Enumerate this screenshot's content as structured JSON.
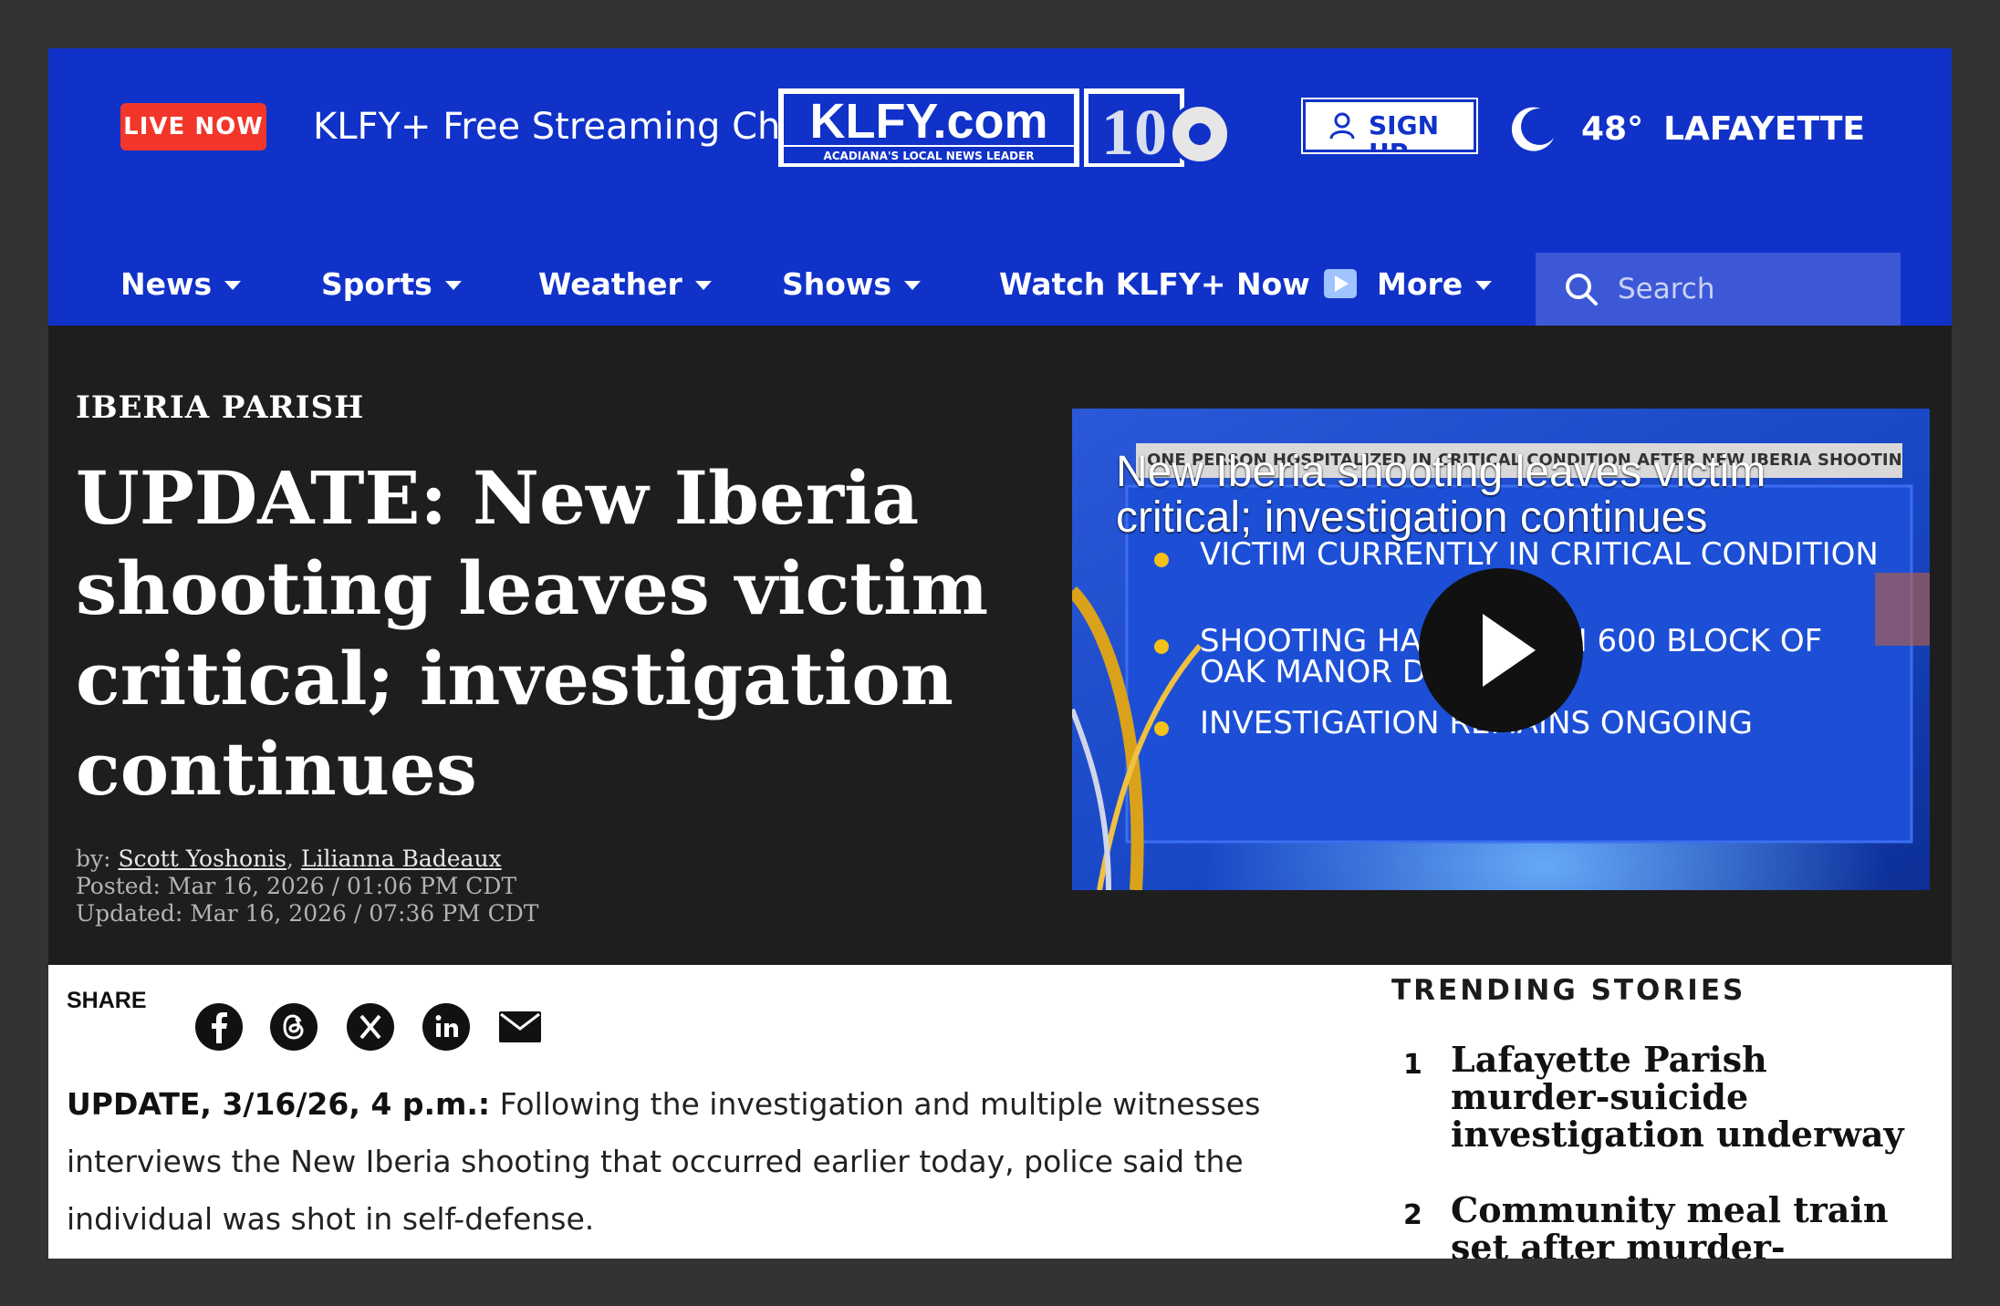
{
  "header": {
    "live_badge": "LIVE NOW",
    "stream_text": "KLFY+ Free Streaming Channel",
    "logo": {
      "text": "KLFY.com",
      "tagline": "ACADIANA'S LOCAL NEWS LEADER",
      "channel": "10"
    },
    "signup_label": "SIGN UP",
    "weather": {
      "temp": "48°",
      "city": "LAFAYETTE",
      "icon": "moon-icon"
    }
  },
  "nav": {
    "items": [
      "News",
      "Sports",
      "Weather",
      "Shows",
      "Watch KLFY+ Now",
      "More"
    ],
    "search_placeholder": "Search"
  },
  "article": {
    "category": "IBERIA PARISH",
    "headline": "UPDATE: New Iberia shooting leaves victim critical; investigation continues",
    "by_prefix": "by: ",
    "authors": [
      "Scott Yoshonis",
      "Lilianna Badeaux"
    ],
    "posted": "Posted: Mar 16, 2026 / 01:06 PM CDT",
    "updated": "Updated: Mar 16, 2026 / 07:36 PM CDT",
    "share_label": "SHARE",
    "share_icons": [
      "facebook-icon",
      "threads-icon",
      "x-icon",
      "linkedin-icon",
      "mail-icon"
    ],
    "update_lead": "UPDATE, 3/16/26, 4 p.m.:",
    "body": "Following the investigation and multiple witnesses interviews the New Iberia shooting that occurred earlier today, police said the individual was shot in self-defense."
  },
  "video": {
    "title": "New Iberia shooting leaves victim critical; investigation continues",
    "strip_text": "ONE PERSON HOSPITALIZED IN CRITICAL CONDITION AFTER NEW IBERIA SHOOTING",
    "bullets": [
      "VICTIM CURRENTLY IN CRITICAL CONDITION",
      "SHOOTING HAPPENED IN 600 BLOCK OF OAK MANOR DRIVE",
      "INVESTIGATION REMAINS ONGOING"
    ]
  },
  "trending": {
    "title": "TRENDING STORIES",
    "items": [
      {
        "num": "1",
        "text": "Lafayette Parish murder-suicide investigation underway"
      },
      {
        "num": "2",
        "text": "Community meal train set after murder-suicide"
      }
    ]
  },
  "colors": {
    "brand_blue": "#1032c9",
    "live_red": "#f2362a",
    "hero_bg": "#1e1e1e",
    "bullet_yellow": "#f3c11a"
  }
}
